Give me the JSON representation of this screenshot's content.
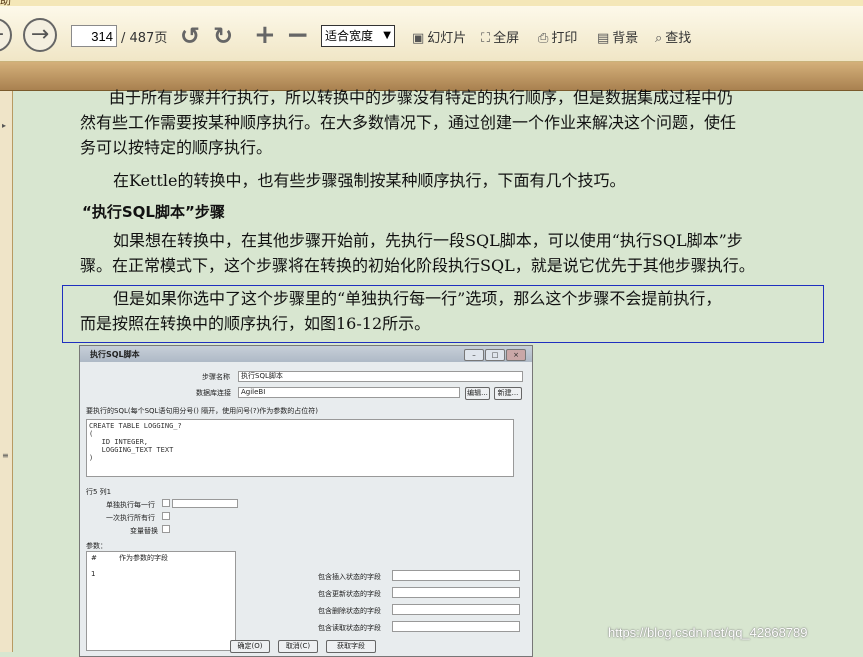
{
  "window": {
    "title_fragment": "助"
  },
  "toolbar": {
    "page_current": "314",
    "page_total": "/ 487页",
    "zoom": "适合宽度",
    "buttons": [
      {
        "icon": "slideshow-icon",
        "label": "幻灯片"
      },
      {
        "icon": "fullscreen-icon",
        "label": "全屏"
      },
      {
        "icon": "print-icon",
        "label": "打印"
      },
      {
        "icon": "background-icon",
        "label": "背景"
      },
      {
        "icon": "search-icon",
        "label": "查找"
      }
    ]
  },
  "document": {
    "p1_line1": "由于所有步骤并行执行，所以转换中的步骤没有特定的执行顺序，但是数据集成过程中仍",
    "p1_line2": "然有些工作需要按某种顺序执行。在大多数情况下，通过创建一个作业来解决这个问题，使任",
    "p1_line3": "务可以按特定的顺序执行。",
    "p2": "在Kettle的转换中，也有些步骤强制按某种顺序执行，下面有几个技巧。",
    "heading": "“执行SQL脚本”步骤",
    "p3_line1": "如果想在转换中，在其他步骤开始前，先执行一段SQL脚本，可以使用“执行SQL脚本”步",
    "p3_line2": "骤。在正常模式下，这个步骤将在转换的初始化阶段执行SQL，就是说它优先于其他步骤执行。",
    "p4_line1": "但是如果你选中了这个步骤里的“单独执行每一行”选项，那么这个步骤不会提前执行，",
    "p4_line2": "而是按照在转换中的顺序执行，如图16-12所示。"
  },
  "figure": {
    "title": "执行SQL脚本",
    "step_name_label": "步骤名称",
    "step_name_value": "执行SQL脚本",
    "db_label": "数据库连接",
    "db_value": "AgileBI",
    "edit_btn": "编辑...",
    "new_btn": "新建...",
    "sql_label": "要执行的SQL(每个SQL语句用分号() 隔开，使用问号(?)作为参数的占位符)",
    "sql_text": "CREATE TABLE LOGGING_?\n(\n   ID INTEGER,\n   LOGGING_TEXT TEXT\n)",
    "rowcol": "行5 列1",
    "exec_each_row": "单独执行每一行",
    "exec_once": "一次执行所有行",
    "var_replace": "变量替换",
    "params_label": "参数：",
    "col_hash": "#",
    "col_field": "作为参数的字段",
    "row1": "1",
    "insert_field": "包含插入状态的字段",
    "update_field": "包含更新状态的字段",
    "delete_field": "包含删除状态的字段",
    "read_field": "包含读取状态的字段",
    "ok_btn": "确定(O)",
    "cancel_btn": "取消(C)",
    "get_fields_btn": "获取字段"
  },
  "watermark": "https://blog.csdn.net/qq_42868789"
}
